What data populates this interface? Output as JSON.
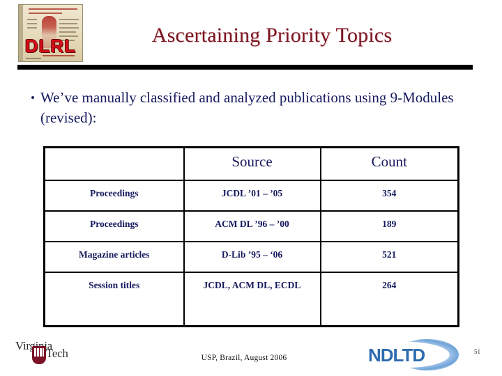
{
  "slide": {
    "title": "Ascertaining Priority Topics",
    "page_number": "51",
    "footer": "USP, Brazil, August 2006",
    "accent_title_color": "#7b1520",
    "body_text_color": "#161a5e",
    "rule_color": "#000000"
  },
  "logos": {
    "dlrl": {
      "name": "dlrl-logo",
      "text": "DLRL",
      "text_color": "#d60f18",
      "background_color": "#e8dec2"
    },
    "virginia_tech": {
      "name": "virginia-tech-logo",
      "line1": "Virginia",
      "line2": "Tech",
      "emblem_color": "#7b1126"
    },
    "ndltd": {
      "name": "ndltd-logo",
      "text": "NDLTD",
      "text_color": "#2f6cb0",
      "arc_color": "#6fa3d8"
    }
  },
  "bullets": [
    {
      "marker": "•",
      "text": "We’ve manually classified and analyzed publications using 9-Modules (revised):"
    }
  ],
  "table": {
    "columns": [
      "",
      "Source",
      "Count"
    ],
    "rows": [
      {
        "category": "Proceedings",
        "source": "JCDL ’01 – ’05",
        "count": "354"
      },
      {
        "category": "Proceedings",
        "source": "ACM DL ’96 – ’00",
        "count": "189"
      },
      {
        "category": "Magazine articles",
        "source": "D-Lib ’95 – ‘06",
        "count": "521"
      },
      {
        "category": "Session titles",
        "source": "JCDL, ACM DL, ECDL",
        "count": "264"
      }
    ]
  }
}
